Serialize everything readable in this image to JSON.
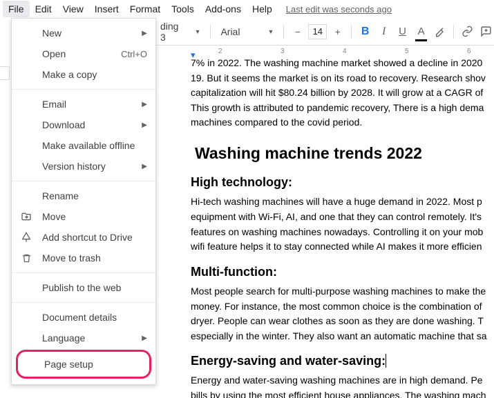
{
  "menubar": {
    "items": [
      "File",
      "Edit",
      "View",
      "Insert",
      "Format",
      "Tools",
      "Add-ons",
      "Help"
    ],
    "last_edit": "Last edit was seconds ago"
  },
  "file_menu": {
    "new": "New",
    "open": "Open",
    "open_shortcut": "Ctrl+O",
    "make_copy": "Make a copy",
    "email": "Email",
    "download": "Download",
    "offline": "Make available offline",
    "version": "Version history",
    "rename": "Rename",
    "move": "Move",
    "add_shortcut": "Add shortcut to Drive",
    "trash": "Move to trash",
    "publish": "Publish to the web",
    "details": "Document details",
    "language": "Language",
    "page_setup": "Page setup"
  },
  "toolbar": {
    "style": "ding 3",
    "font": "Arial",
    "fontsize": "14"
  },
  "ruler": {
    "t2": "2",
    "t3": "3",
    "t4": "4",
    "t5": "5",
    "t6": "6"
  },
  "doc": {
    "p1": "7% in 2022. The washing machine market showed a decline in 2020",
    "p2": "19. But it seems the market is on its road to recovery. Research shov",
    "p3": "capitalization will hit $80.24 billion by 2028. It will grow at a CAGR of",
    "p4": "This growth is attributed to pandemic recovery, There is a high dema",
    "p5": "machines compared to the covid period.",
    "h1": "Washing machine trends 2022",
    "h2a": "High technology:",
    "pa1": "Hi-tech washing machines will have a huge demand in 2022. Most p",
    "pa2": "equipment with Wi-Fi, AI, and one that they can control remotely. It's",
    "pa3": "features on washing machines nowadays. Controlling it on your mob",
    "pa4": "wifi feature helps it to stay connected while AI makes it more efficien",
    "h2b": "Multi-function:",
    "pb1": "Most people search for multi-purpose washing machines to make the",
    "pb2": "money. For instance, the most common choice is the combination of",
    "pb3": "dryer. People can wear clothes as soon as they are done washing. T",
    "pb4": "especially in the winter. They also want an automatic machine that sa",
    "h2c": "Energy-saving and water-saving:",
    "pc1": "Energy and water-saving washing machines are in high demand. Pe",
    "pc2": "bills by using the most efficient house appliances. The washing mach"
  }
}
